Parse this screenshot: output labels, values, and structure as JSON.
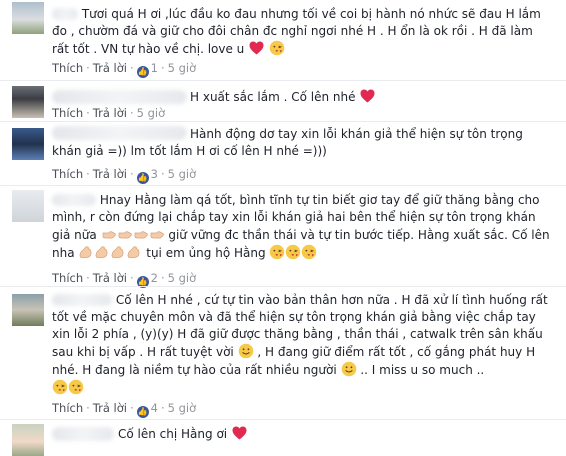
{
  "comments": [
    {
      "text_parts": [
        "Tươi quá H ơi ,lúc đầu ko đau nhưng tối về coi bị hành nó nhức sẽ đau H lắm đo , chườm đá và giữ cho đôi chân đc nghỉ ngơi nhé H . H ổn là ok rồi . H đã làm rất tốt . VN tự hào về chị. love u"
      ],
      "like_label": "Thích",
      "reply_label": "Trả lời",
      "like_count": "1",
      "time": "5 giờ"
    },
    {
      "text_parts": [
        "H xuất sắc lắm . Cố lên nhé"
      ],
      "like_label": "Thích",
      "reply_label": "Trả lời",
      "time": "5 giờ"
    },
    {
      "text_parts": [
        "Hành động dơ tay xin lỗi khán giả thể hiện sự tôn trọng khán giả =)) lm tốt lắm H ơi cố lên H nhé =)))"
      ],
      "like_label": "Thích",
      "reply_label": "Trả lời",
      "like_count": "3",
      "time": "5 giờ"
    },
    {
      "text_parts": [
        "Hnay Hằng làm qá tốt, bình tĩnh tự tin biết giơ tay để giữ thăng bằng cho mình, r còn đứng lại chắp tay xin lỗi khán giả hai bên thể hiện sự tôn trọng khán giả nữa",
        "giữ vững đc thần thái và tự tin bước tiếp. Hằng xuất sắc. Cố lên nha",
        "tụi em ủng hộ Hằng"
      ],
      "like_label": "Thích",
      "reply_label": "Trả lời",
      "like_count": "2",
      "time": "5 giờ"
    },
    {
      "text_parts": [
        "Cố lên H nhé , cứ tự tin vào bản thân hơn nữa . H đã xử lí tình huống rất tốt về mặc chuyên môn và đã thể hiện sự tôn trọng khán giả bằng việc chắp tay xin lỗi 2 phía , (y)(y) H đã giữ được thăng bằng , thần thái , catwalk trên sân khấu sau khi bị vấp . H rất tuyệt vời",
        ", H đang giữ điểm rất tốt , cố gắng phát huy H nhé. H đang là niềm tự hào của rất nhiều người",
        ".. I miss u so much .."
      ],
      "like_label": "Thích",
      "reply_label": "Trả lời",
      "like_count": "4",
      "time": "5 giờ"
    },
    {
      "text_parts": [
        "Cố lên chị Hằng ơi"
      ]
    }
  ],
  "icons": {
    "like_badge": "like-thumb-icon",
    "heart": "heart-icon",
    "kiss": "kiss-face-icon",
    "smile": "smile-face-icon",
    "hand": "pointing-hand-icon",
    "arm": "flexed-arm-icon"
  },
  "colors": {
    "link_gray": "#4b4f56",
    "meta_gray": "#90949c",
    "fb_blue": "#3b5998",
    "heart_red": "#e02a52"
  }
}
